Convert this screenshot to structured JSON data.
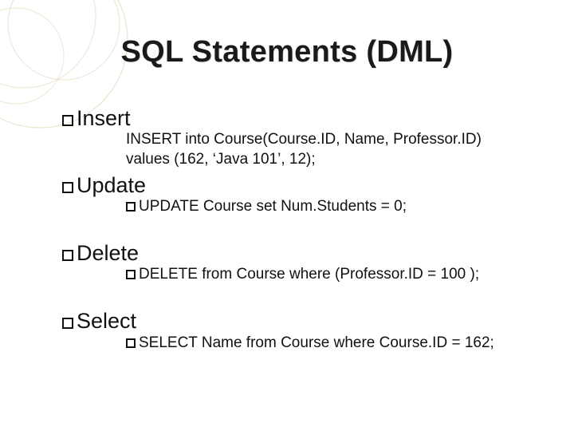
{
  "title": "SQL Statements (DML)",
  "items": {
    "insert": {
      "label": "Insert",
      "line1": "INSERT into Course(Course.ID, Name, Professor.ID)",
      "line2": "values  (162, ‘Java 101’, 12);"
    },
    "update": {
      "label": "Update",
      "stmt": "UPDATE Course set Num.Students = 0;"
    },
    "delete": {
      "label": "Delete",
      "stmt": "DELETE from Course where (Professor.ID = 100 );"
    },
    "select": {
      "label": "Select",
      "stmt": "SELECT Name from Course where Course.ID = 162;"
    }
  }
}
